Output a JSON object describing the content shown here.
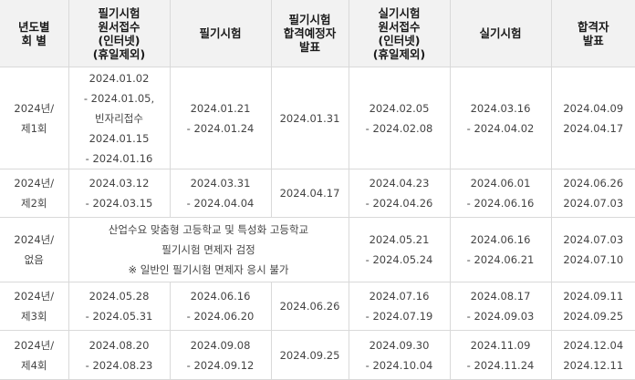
{
  "headers": [
    [
      "년도별",
      "회 별"
    ],
    [
      "필기시험",
      "원서접수",
      "(인터넷)",
      "(휴일제외)"
    ],
    [
      "필기시험"
    ],
    [
      "필기시험",
      "합격예정자",
      "발표"
    ],
    [
      "실기시험",
      "원서접수",
      "(인터넷)",
      "(휴일제외)"
    ],
    [
      "실기시험"
    ],
    [
      "합격자",
      "발표"
    ]
  ],
  "rows": [
    {
      "round": [
        "2024년/",
        "제1회"
      ],
      "written_application": [
        "2024.01.02",
        "- 2024.01.05,",
        "빈자리접수",
        "2024.01.15",
        "- 2024.01.16"
      ],
      "written_exam": [
        "2024.01.21",
        "- 2024.01.24"
      ],
      "written_result": [
        "2024.01.31"
      ],
      "practical_application": [
        "2024.02.05",
        "- 2024.02.08"
      ],
      "practical_exam": [
        "2024.03.16",
        "- 2024.04.02"
      ],
      "final_result": [
        "2024.04.09",
        "2024.04.17"
      ]
    },
    {
      "round": [
        "2024년/",
        "제2회"
      ],
      "written_application": [
        "2024.03.12",
        "- 2024.03.15"
      ],
      "written_exam": [
        "2024.03.31",
        "- 2024.04.04"
      ],
      "written_result": [
        "2024.04.17"
      ],
      "practical_application": [
        "2024.04.23",
        "- 2024.04.26"
      ],
      "practical_exam": [
        "2024.06.01",
        "- 2024.06.16"
      ],
      "final_result": [
        "2024.06.26",
        "2024.07.03"
      ]
    },
    {
      "round": [
        "2024년/",
        "없음"
      ],
      "notice": [
        "산업수요 맞춤형 고등학교 및 특성화 고등학교",
        "필기시험 면제자 검정",
        "※ 일반인 필기시험 면제자 응시 불가"
      ],
      "practical_application": [
        "2024.05.21",
        "- 2024.05.24"
      ],
      "practical_exam": [
        "2024.06.16",
        "- 2024.06.21"
      ],
      "final_result": [
        "2024.07.03",
        "2024.07.10"
      ]
    },
    {
      "round": [
        "2024년/",
        "제3회"
      ],
      "written_application": [
        "2024.05.28",
        "- 2024.05.31"
      ],
      "written_exam": [
        "2024.06.16",
        "- 2024.06.20"
      ],
      "written_result": [
        "2024.06.26"
      ],
      "practical_application": [
        "2024.07.16",
        "- 2024.07.19"
      ],
      "practical_exam": [
        "2024.08.17",
        "- 2024.09.03"
      ],
      "final_result": [
        "2024.09.11",
        "2024.09.25"
      ]
    },
    {
      "round": [
        "2024년/",
        "제4회"
      ],
      "written_application": [
        "2024.08.20",
        "- 2024.08.23"
      ],
      "written_exam": [
        "2024.09.08",
        "- 2024.09.12"
      ],
      "written_result": [
        "2024.09.25"
      ],
      "practical_application": [
        "2024.09.30",
        "- 2024.10.04"
      ],
      "practical_exam": [
        "2024.11.09",
        "- 2024.11.24"
      ],
      "final_result": [
        "2024.12.04",
        "2024.12.11"
      ]
    }
  ]
}
